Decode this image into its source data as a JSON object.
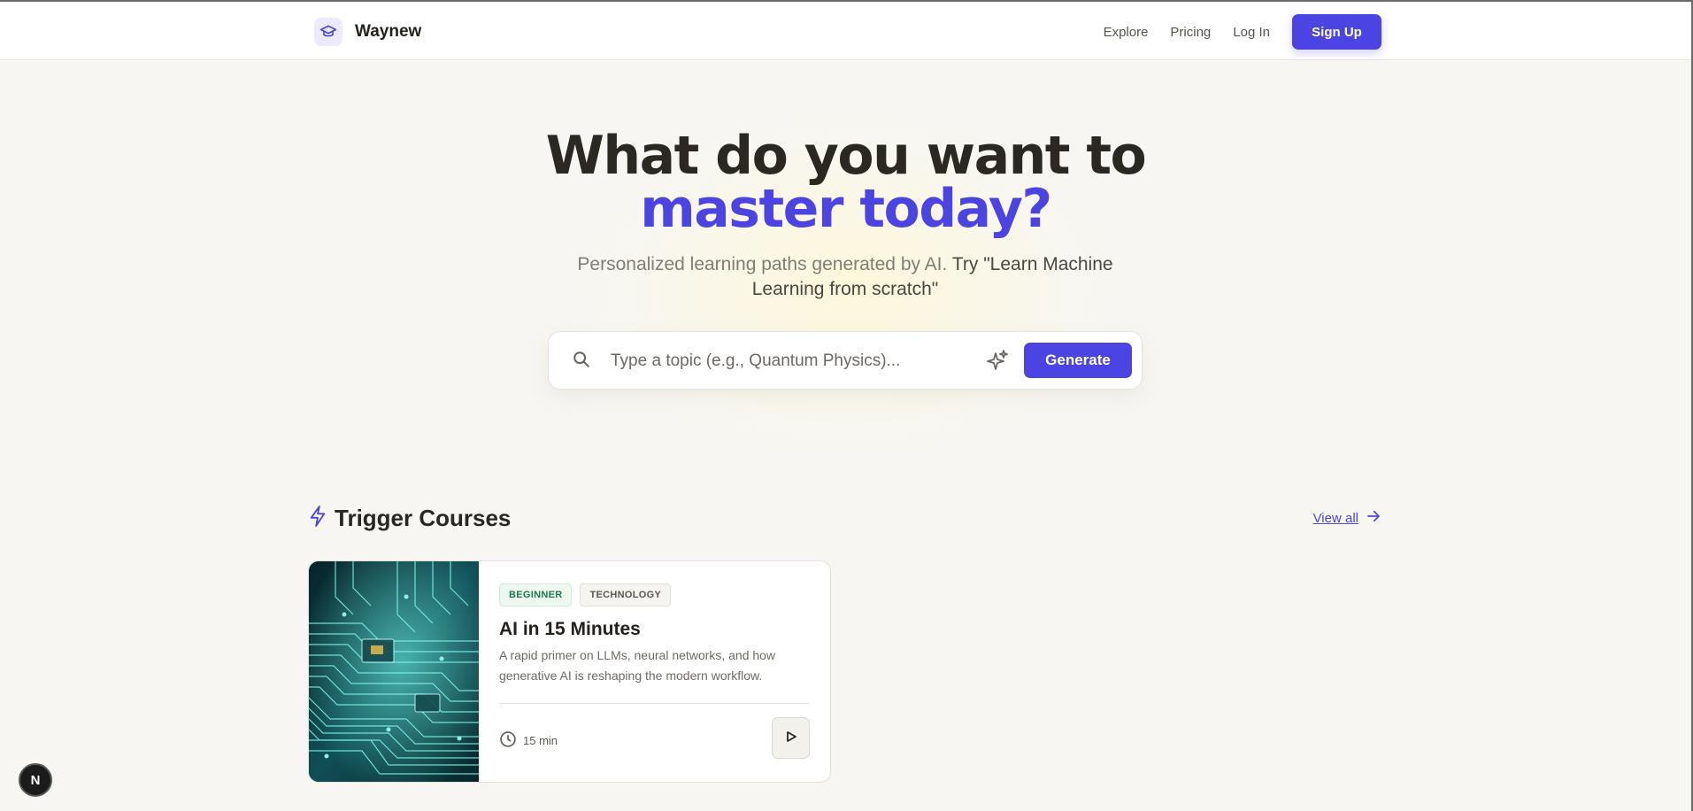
{
  "header": {
    "brand_name": "Waynew",
    "nav": [
      {
        "label": "Explore"
      },
      {
        "label": "Pricing"
      },
      {
        "label": "Log In"
      }
    ],
    "signup_label": "Sign Up"
  },
  "hero": {
    "title_line1": "What do you want to",
    "title_line2": "master today?",
    "subtitle_plain": "Personalized learning paths generated by AI.",
    "subtitle_emphasis": "Try \"Learn Machine Learning from scratch\""
  },
  "search": {
    "placeholder": "Type a topic (e.g., Quantum Physics)...",
    "value": "",
    "button_label": "Generate",
    "icons": [
      "search-icon",
      "sparkles-icon"
    ]
  },
  "section": {
    "title": "Trigger Courses",
    "icon": "lightning-icon",
    "view_all_label": "View all"
  },
  "courses": [
    {
      "tags": [
        "BEGINNER",
        "TECHNOLOGY"
      ],
      "title": "AI in 15 Minutes",
      "description": "A rapid primer on LLMs, neural networks, and how generative AI is reshaping the modern workflow.",
      "duration": "15 min",
      "image": "circuit-board-image"
    }
  ],
  "floating_button": {
    "label": "N"
  },
  "colors": {
    "accent": "#4b44e3",
    "background": "#f7f6f3",
    "highlight": "#fbeea0",
    "tag_green": "#1f7a46"
  }
}
